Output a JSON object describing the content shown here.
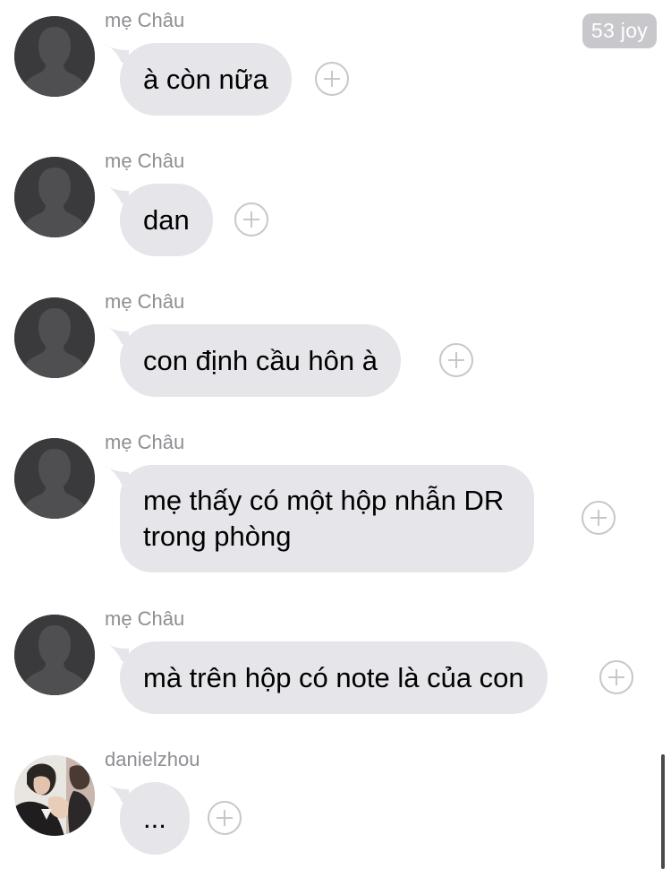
{
  "chat": {
    "badge": "53 joy",
    "messages": [
      {
        "sender": "mẹ Châu",
        "text": "à còn nữa",
        "avatar": "default-silhouette"
      },
      {
        "sender": "mẹ Châu",
        "text": "dan",
        "avatar": "default-silhouette"
      },
      {
        "sender": "mẹ Châu",
        "text": "con định cầu hôn à",
        "avatar": "default-silhouette"
      },
      {
        "sender": "mẹ Châu",
        "lines": [
          "mẹ thấy có một hộp nhẫn DR",
          "trong phòng"
        ],
        "avatar": "default-silhouette"
      },
      {
        "sender": "mẹ Châu",
        "text": "mà trên hộp có note là của con",
        "avatar": "default-silhouette"
      },
      {
        "sender": "danielzhou",
        "text": "...",
        "avatar": "photo"
      }
    ]
  },
  "colors": {
    "bubble": "#e5e5ea",
    "sender": "#8e8e93",
    "badge": "#c8c8cc",
    "plus": "#c7c7cc"
  },
  "icons": {
    "add_reaction": "plus-circle-icon",
    "default_avatar": "person-silhouette-icon"
  }
}
